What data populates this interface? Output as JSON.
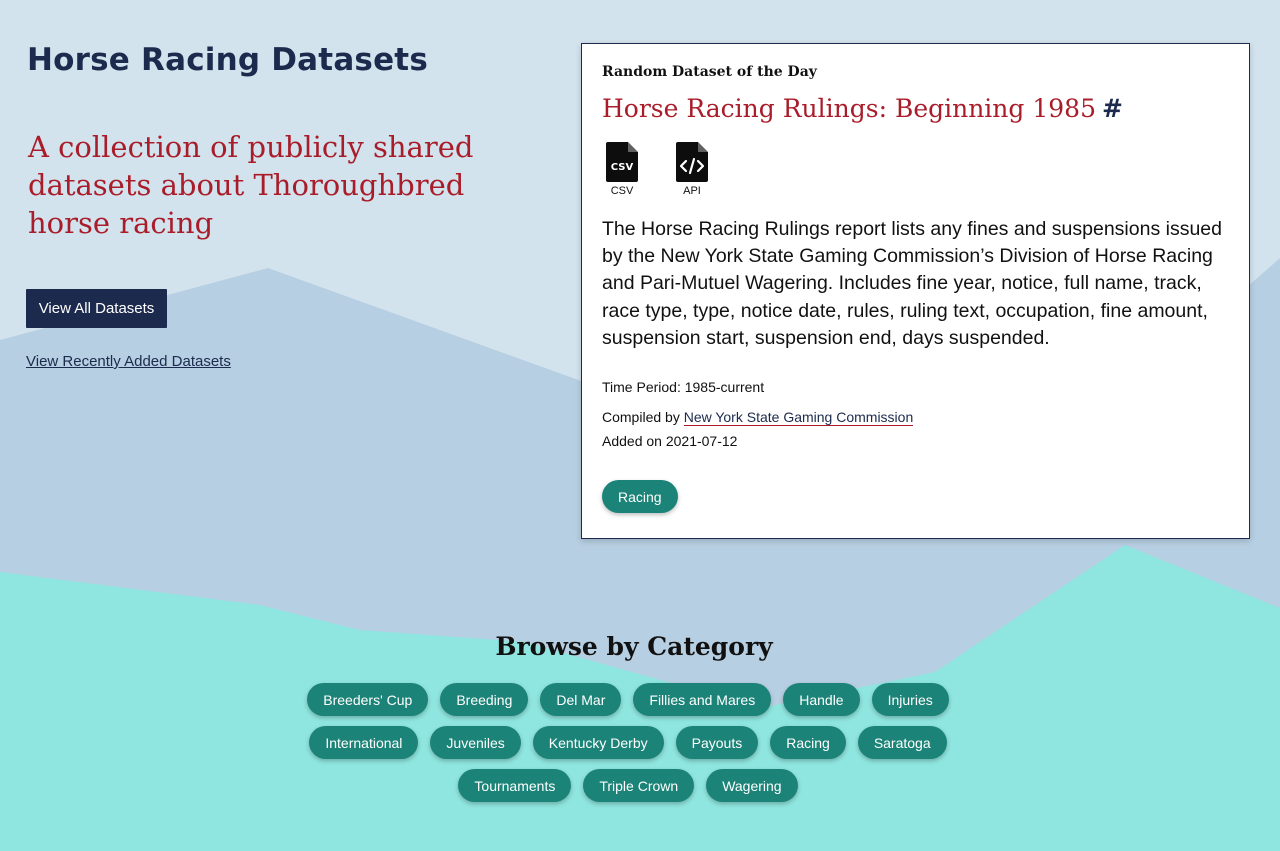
{
  "site": {
    "title": "Horse Racing Datasets",
    "tagline": "A collection of publicly shared datasets about Thoroughbred horse racing"
  },
  "actions": {
    "view_all": "View All Datasets",
    "view_recent": "View Recently Added Datasets"
  },
  "featured": {
    "kicker": "Random Dataset of the Day",
    "title": "Horse Racing Rulings: Beginning 1985",
    "anchor": "#",
    "files": [
      {
        "label": "CSV",
        "icon": "csv-file-icon"
      },
      {
        "label": "API",
        "icon": "api-file-icon"
      }
    ],
    "description": "The Horse Racing Rulings report lists any fines and suspensions issued by the New York State Gaming Commission’s Division of Horse Racing and Pari-Mutuel Wagering. Includes fine year, notice, full name, track, race type, type, notice date, rules, ruling text, occupation, fine amount, suspension start, suspension end, days suspended.",
    "time_period": "Time Period: 1985-current",
    "compiled_prefix": "Compiled by ",
    "compiled_by": "New York State Gaming Commission",
    "added": "Added on 2021-07-12",
    "tag": "Racing"
  },
  "browse": {
    "heading": "Browse by Category",
    "rows": [
      [
        "Breeders' Cup",
        "Breeding",
        "Del Mar",
        "Fillies and Mares",
        "Handle",
        "Injuries"
      ],
      [
        "International",
        "Juveniles",
        "Kentucky Derby",
        "Payouts",
        "Racing",
        "Saratoga"
      ],
      [
        "Tournaments",
        "Triple Crown",
        "Wagering"
      ]
    ]
  },
  "colors": {
    "navy": "#1c2a4d",
    "red": "#a91d2a",
    "teal_pill": "#1b8377",
    "sky": "#d3e3ee",
    "mountain": "#b6cfe1",
    "turquoise": "#8ee6e0"
  }
}
